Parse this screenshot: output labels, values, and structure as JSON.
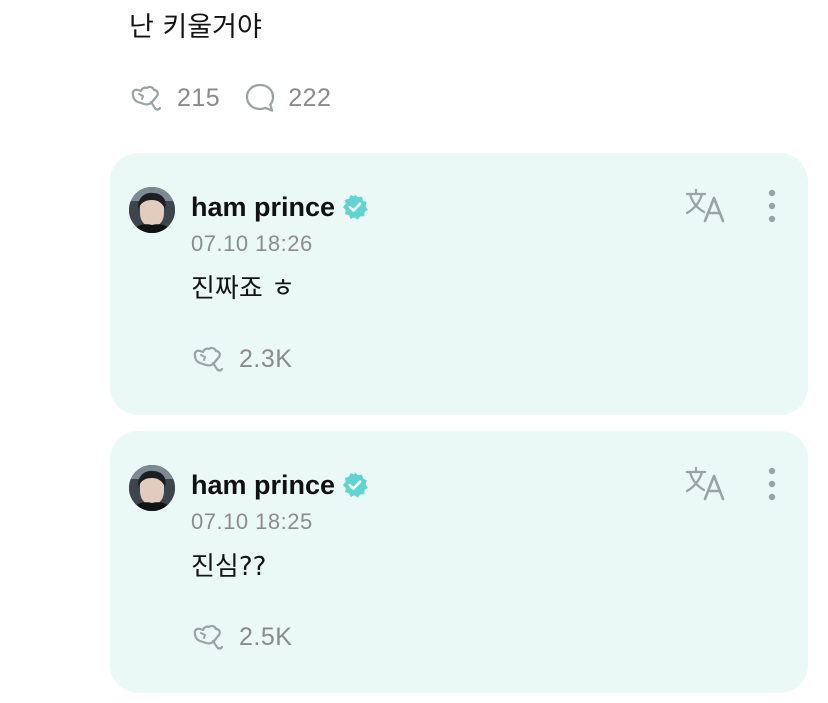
{
  "post": {
    "text": "난 키울거야",
    "likes": "215",
    "comments": "222"
  },
  "replies": [
    {
      "author": "ham prince",
      "verified": true,
      "timestamp": "07.10 18:26",
      "text": "진짜죠 ㅎ",
      "likes": "2.3K"
    },
    {
      "author": "ham prince",
      "verified": true,
      "timestamp": "07.10 18:25",
      "text": "진심??",
      "likes": "2.5K"
    }
  ],
  "icons": {
    "like": "heart-hand-icon",
    "comment": "comment-bubble-icon",
    "verified": "verified-badge-icon",
    "translate": "translate-icon",
    "more": "more-vertical-icon"
  },
  "colors": {
    "card_background": "#ebf9f6",
    "verified_badge": "#5fd4d0",
    "muted_text": "#8c8c8c",
    "icon_gray": "#9aa3a3"
  }
}
